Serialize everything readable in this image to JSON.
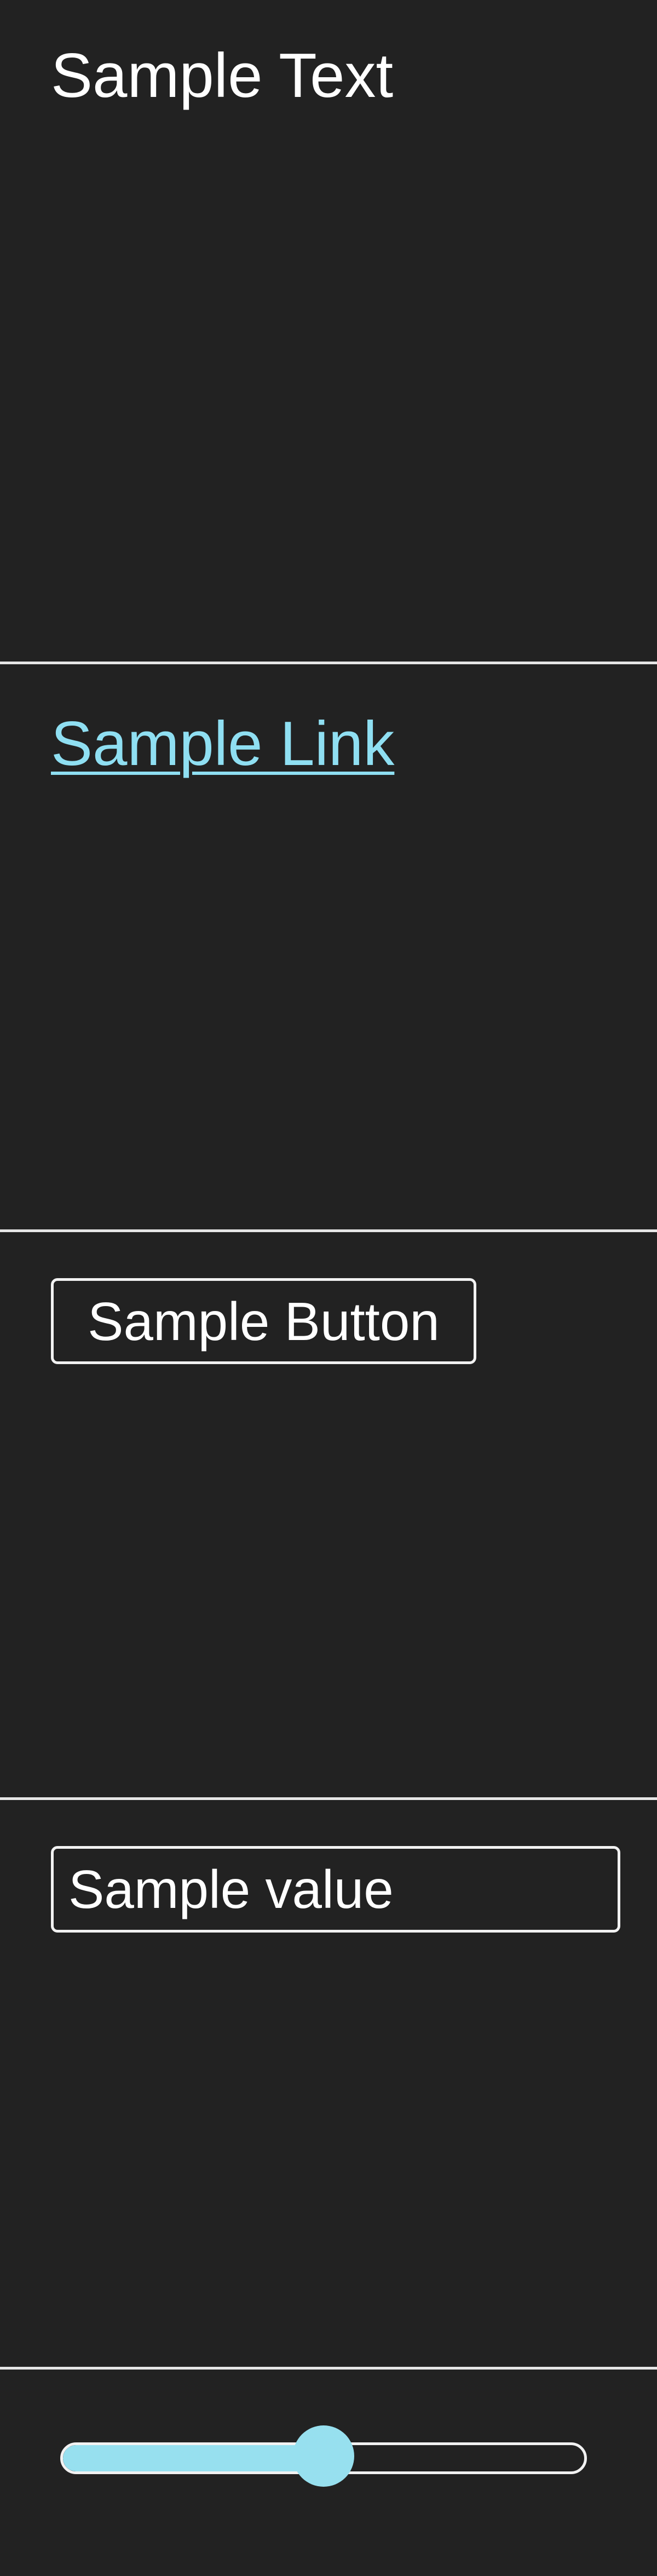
{
  "text_section": {
    "text": "Sample Text"
  },
  "link_section": {
    "label": "Sample Link"
  },
  "button_section": {
    "label": "Sample Button"
  },
  "input_section": {
    "value": "Sample value"
  },
  "slider_section": {
    "value": 0.5
  },
  "colors": {
    "background": "#222222",
    "foreground": "#ffffff",
    "link": "#8fdff2",
    "accent": "#97e0ef",
    "border": "#f2f2f2"
  }
}
